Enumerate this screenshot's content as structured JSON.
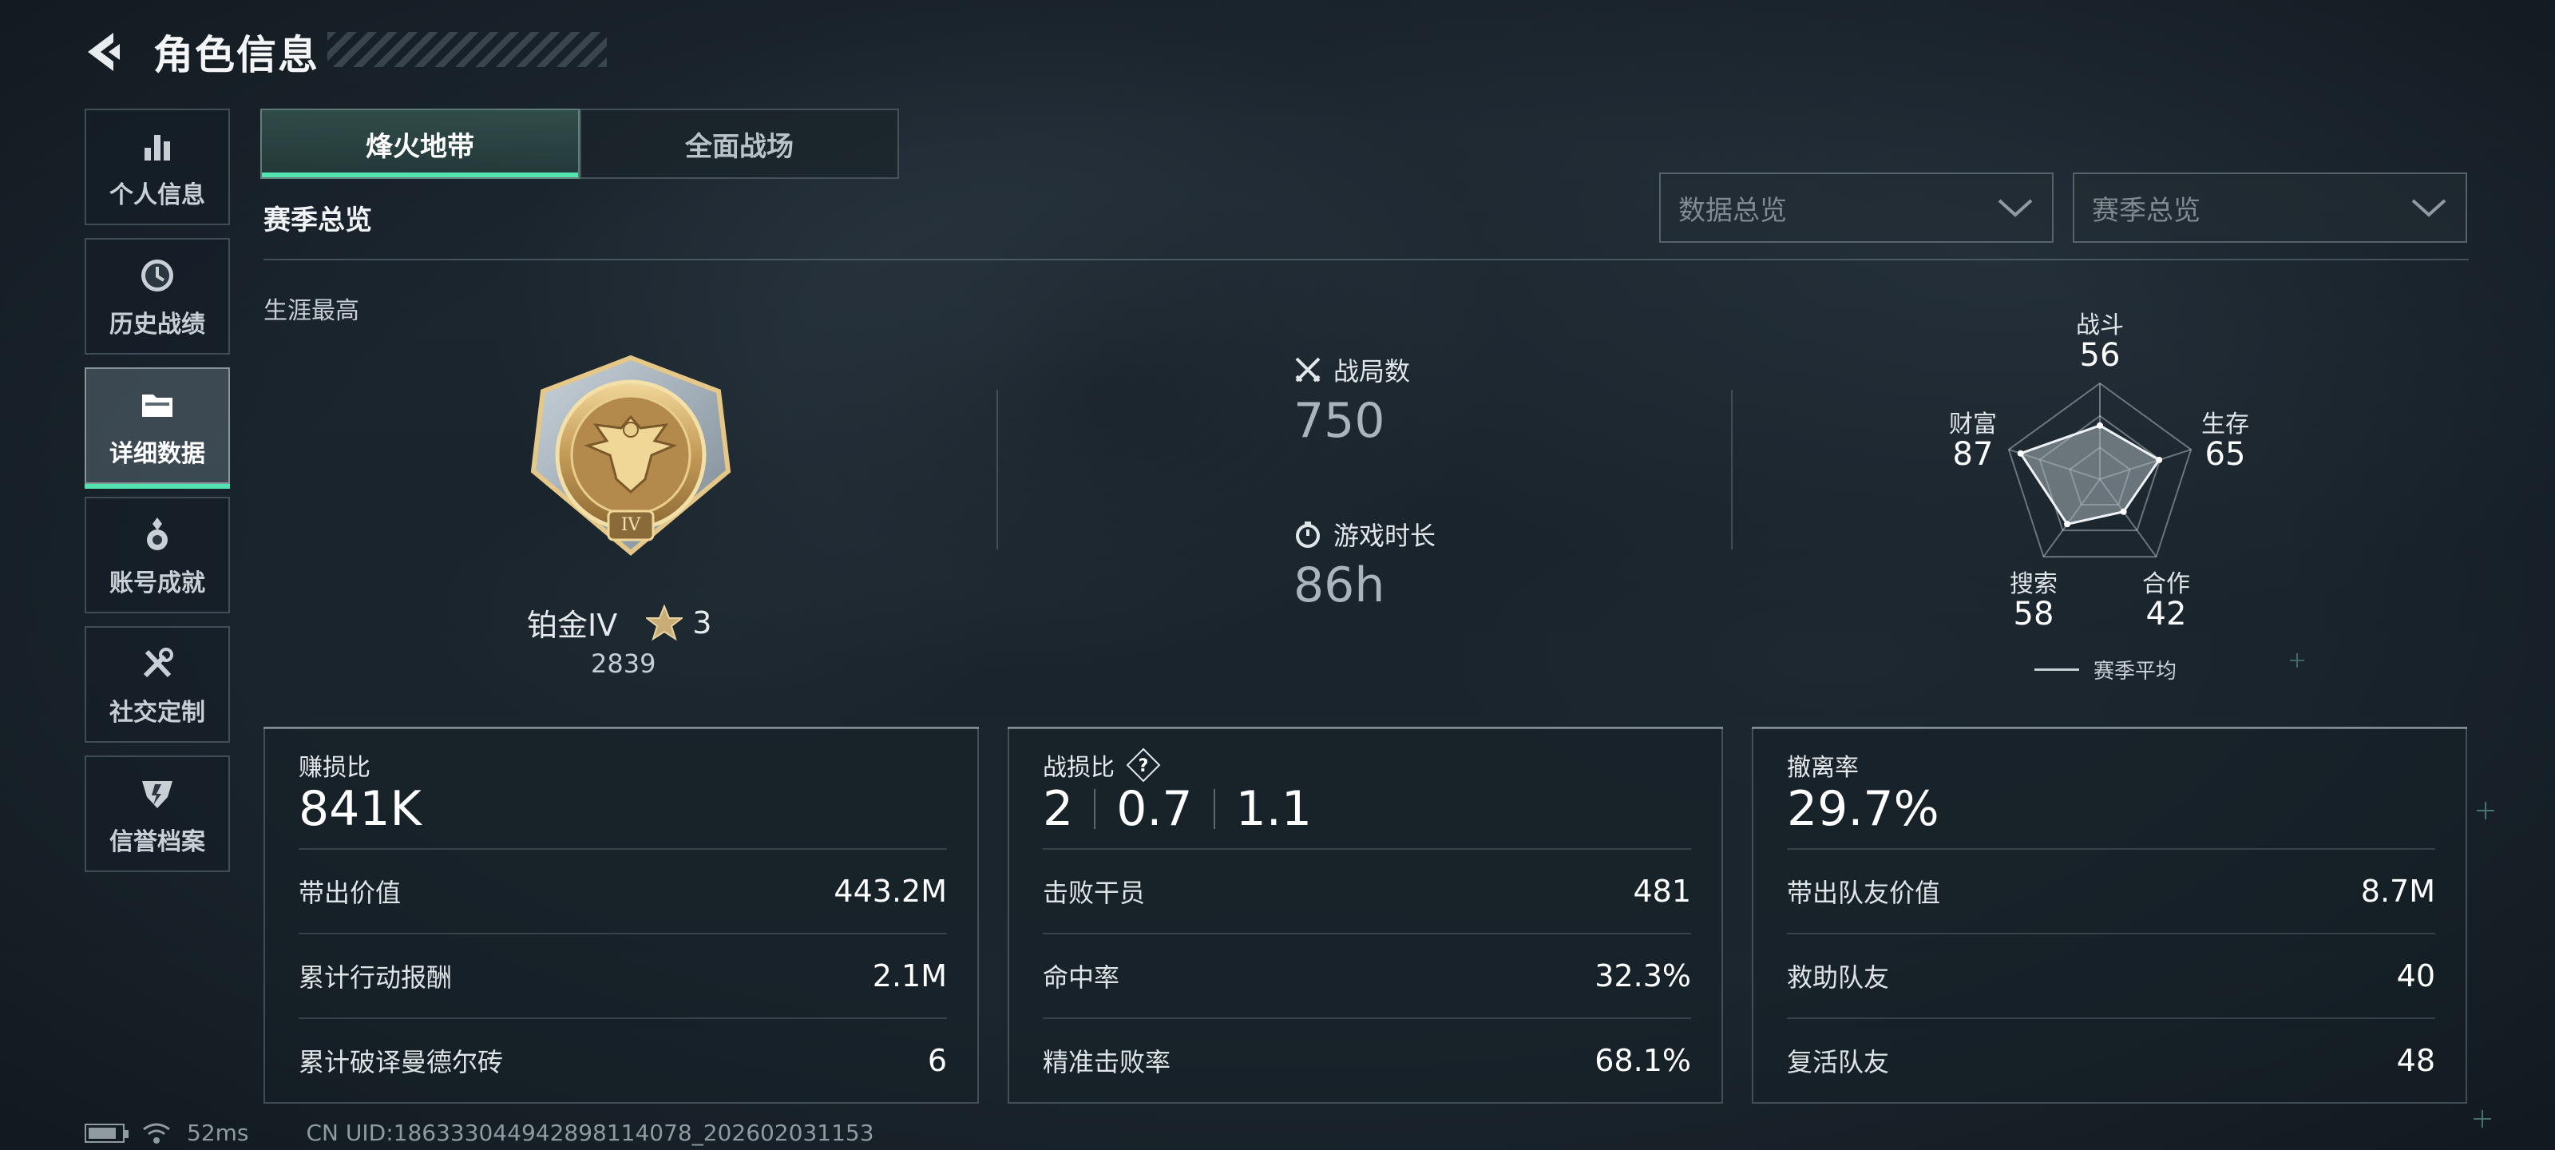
{
  "header": {
    "title": "角色信息"
  },
  "sidebar": {
    "items": [
      {
        "label": "个人信息",
        "icon": "bar-chart-icon",
        "active": false
      },
      {
        "label": "历史战绩",
        "icon": "history-clock-icon",
        "active": false
      },
      {
        "label": "详细数据",
        "icon": "folder-icon",
        "active": true
      },
      {
        "label": "账号成就",
        "icon": "achievement-medal-icon",
        "active": false
      },
      {
        "label": "社交定制",
        "icon": "tools-icon",
        "active": false
      },
      {
        "label": "信誉档案",
        "icon": "credit-badge-icon",
        "active": false
      }
    ]
  },
  "mode_tabs": [
    {
      "label": "烽火地带",
      "active": true
    },
    {
      "label": "全面战场",
      "active": false
    }
  ],
  "section_title": "赛季总览",
  "dropdowns": [
    {
      "label": "数据总览"
    },
    {
      "label": "赛季总览"
    }
  ],
  "career": {
    "label": "生涯最高",
    "rank_name": "铂金IV",
    "stars": "3",
    "score": "2839",
    "emblem_numeral": "IV"
  },
  "match_stats": {
    "matches_label": "战局数",
    "matches_value": "750",
    "playtime_label": "游戏时长",
    "playtime_value": "86h"
  },
  "radar": {
    "axes": [
      {
        "label": "战斗",
        "value": "56"
      },
      {
        "label": "生存",
        "value": "65"
      },
      {
        "label": "合作",
        "value": "42"
      },
      {
        "label": "搜索",
        "value": "58"
      },
      {
        "label": "财富",
        "value": "87"
      }
    ],
    "legend": "赛季平均"
  },
  "cards": [
    {
      "title": "赚损比",
      "big": "841K",
      "rows": [
        {
          "label": "带出价值",
          "value": "443.2M"
        },
        {
          "label": "累计行动报酬",
          "value": "2.1M"
        },
        {
          "label": "累计破译曼德尔砖",
          "value": "6"
        }
      ]
    },
    {
      "title": "战损比",
      "big_parts": [
        "2",
        "0.7",
        "1.1"
      ],
      "rows": [
        {
          "label": "击败干员",
          "value": "481"
        },
        {
          "label": "命中率",
          "value": "32.3%"
        },
        {
          "label": "精准击败率",
          "value": "68.1%"
        }
      ]
    },
    {
      "title": "撤离率",
      "big": "29.7%",
      "rows": [
        {
          "label": "带出队友价值",
          "value": "8.7M"
        },
        {
          "label": "救助队友",
          "value": "40"
        },
        {
          "label": "复活队友",
          "value": "48"
        }
      ]
    }
  ],
  "status_bar": {
    "ping": "52ms",
    "uid": "CN UID:18633304494289811407­8_202602031153"
  },
  "colors": {
    "accent": "#52e3b0",
    "background": "#1d2730",
    "gold": "#c9a86a"
  }
}
